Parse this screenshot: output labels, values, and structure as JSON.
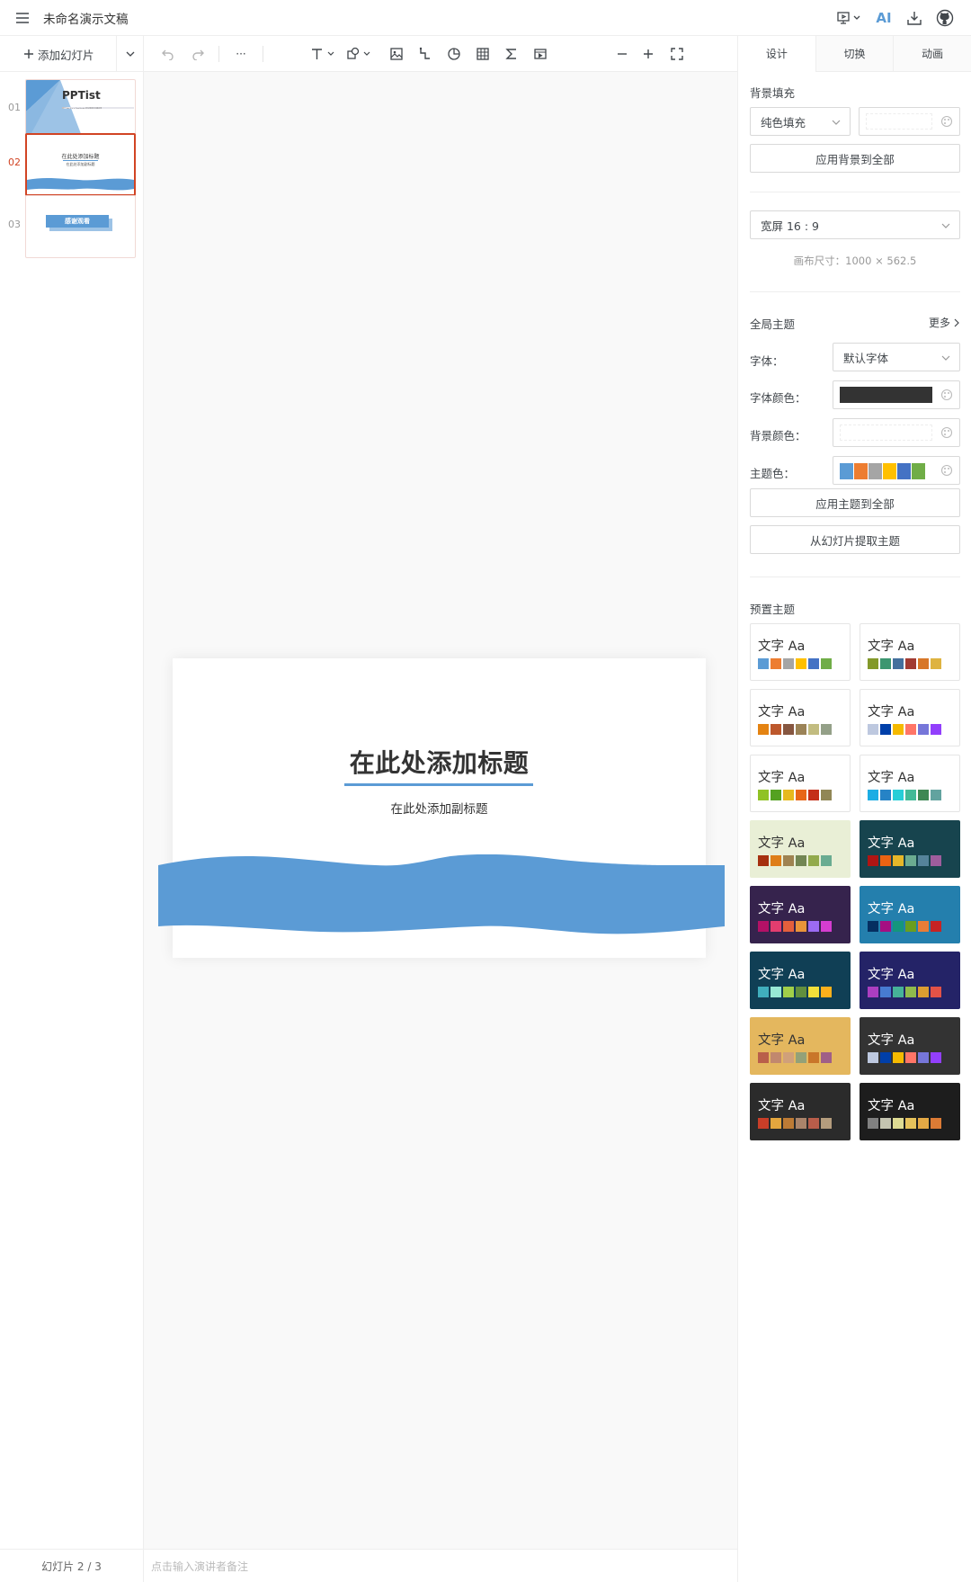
{
  "header": {
    "doc_title": "未命名演示文稿",
    "ai_label": "AI"
  },
  "toolbar": {
    "add_slide_label": "添加幻灯片",
    "more_label": "···"
  },
  "right_tabs": [
    "设计",
    "切换",
    "动画"
  ],
  "thumbnails": [
    {
      "num": "01",
      "title": "PPTist",
      "subtitle": "基于 Vue 3.x + TypeScript 的在线演示文稿应用"
    },
    {
      "num": "02",
      "title": "在此处添加标题",
      "subtitle": "在此处添加副标题"
    },
    {
      "num": "03",
      "title": "感谢观看"
    }
  ],
  "slide": {
    "title": "在此处添加标题",
    "subtitle": "在此处添加副标题",
    "wave_color": "#5b9bd5"
  },
  "notes": {
    "slide_counter": "幻灯片 2 / 3",
    "placeholder": "点击输入演讲者备注"
  },
  "design": {
    "bg_fill_label": "背景填充",
    "bg_fill_type": "纯色填充",
    "apply_bg_all": "应用背景到全部",
    "ratio": "宽屏 16 : 9",
    "canvas_size": "画布尺寸：1000 × 562.5",
    "global_theme_label": "全局主题",
    "more_label": "更多",
    "font_label": "字体：",
    "font_value": "默认字体",
    "font_color_label": "字体颜色：",
    "font_color": "#333333",
    "bg_color_label": "背景颜色：",
    "theme_color_label": "主题色：",
    "theme_colors": [
      "#5b9bd5",
      "#ed7d31",
      "#a5a5a5",
      "#ffc000",
      "#4472c4",
      "#70ad47"
    ],
    "apply_theme_all": "应用主题到全部",
    "extract_theme": "从幻灯片提取主题",
    "preset_label": "预置主题"
  },
  "preset_themes": [
    {
      "text": "文字 Aa",
      "bg": "#ffffff",
      "fg": "#333333",
      "colors": [
        "#5b9bd5",
        "#ed7d31",
        "#a5a5a5",
        "#ffc000",
        "#4472c4",
        "#70ad47"
      ]
    },
    {
      "text": "文字 Aa",
      "bg": "#ffffff",
      "fg": "#333333",
      "colors": [
        "#83992a",
        "#3c9670",
        "#44709d",
        "#a23b32",
        "#d87728",
        "#deb340"
      ]
    },
    {
      "text": "文字 Aa",
      "bg": "#ffffff",
      "fg": "#333333",
      "colors": [
        "#e48312",
        "#bd582c",
        "#865640",
        "#9b8357",
        "#c2bc80",
        "#94a088"
      ]
    },
    {
      "text": "文字 Aa",
      "bg": "#ffffff",
      "fg": "#333333",
      "colors": [
        "#bdc8df",
        "#003fa9",
        "#f5ba00",
        "#ff7567",
        "#7676d9",
        "#923ffc"
      ]
    },
    {
      "text": "文字 Aa",
      "bg": "#ffffff",
      "fg": "#333333",
      "colors": [
        "#90c225",
        "#54a121",
        "#e6b91e",
        "#e86618",
        "#c42f19",
        "#918756"
      ]
    },
    {
      "text": "文字 Aa",
      "bg": "#ffffff",
      "fg": "#333333",
      "colors": [
        "#1cade4",
        "#2683c6",
        "#27ced7",
        "#42ba97",
        "#3e8853",
        "#62a39f"
      ]
    },
    {
      "text": "文字 Aa",
      "bg": "#e9efd6",
      "fg": "#333333",
      "colors": [
        "#a5300f",
        "#de7e18",
        "#9f8351",
        "#728653",
        "#92aa4c",
        "#6aac91"
      ]
    },
    {
      "text": "文字 Aa",
      "bg": "#17444e",
      "fg": "#ffffff",
      "colors": [
        "#b01513",
        "#ea6312",
        "#e6b729",
        "#6bab90",
        "#55839a",
        "#9e5d9d"
      ]
    },
    {
      "text": "文字 Aa",
      "bg": "#36234d",
      "fg": "#ffffff",
      "colors": [
        "#b31166",
        "#e33d6f",
        "#e45f3c",
        "#e9943a",
        "#9b6bf2",
        "#d53dd0"
      ]
    },
    {
      "text": "文字 Aa",
      "bg": "#247fad",
      "fg": "#ffffff",
      "colors": [
        "#052f61",
        "#a50e82",
        "#14967c",
        "#6a9e1f",
        "#e87d37",
        "#c62324"
      ]
    },
    {
      "text": "文字 Aa",
      "bg": "#103f55",
      "fg": "#ffffff",
      "colors": [
        "#40aebd",
        "#97e8d5",
        "#a1cf49",
        "#628f3e",
        "#f2df3a",
        "#fcb01c"
      ]
    },
    {
      "text": "文字 Aa",
      "bg": "#242367",
      "fg": "#ffffff",
      "colors": [
        "#ac3ec1",
        "#477bd1",
        "#46b298",
        "#90ba4c",
        "#dd9d31",
        "#e25247"
      ]
    },
    {
      "text": "文字 Aa",
      "bg": "#e4b75e",
      "fg": "#333333",
      "colors": [
        "#b95f4a",
        "#c1886e",
        "#d0a07a",
        "#93a178",
        "#c9762a",
        "#a05f87"
      ]
    },
    {
      "text": "文字 Aa",
      "bg": "#333333",
      "fg": "#ffffff",
      "colors": [
        "#bdc8df",
        "#003fa9",
        "#f5ba00",
        "#ff7567",
        "#7676d9",
        "#923ffc"
      ]
    },
    {
      "text": "文字 Aa",
      "bg": "#2b2b2b",
      "fg": "#ffffff",
      "colors": [
        "#c83e28",
        "#e4a63e",
        "#bd7b35",
        "#aa846a",
        "#b85d4a",
        "#b49c7d"
      ]
    },
    {
      "text": "文字 Aa",
      "bg": "#1d1d1d",
      "fg": "#ffffff",
      "colors": [
        "#808080",
        "#c4c4b0",
        "#dedb93",
        "#e6c25b",
        "#e4a945",
        "#dc7b35"
      ]
    }
  ]
}
